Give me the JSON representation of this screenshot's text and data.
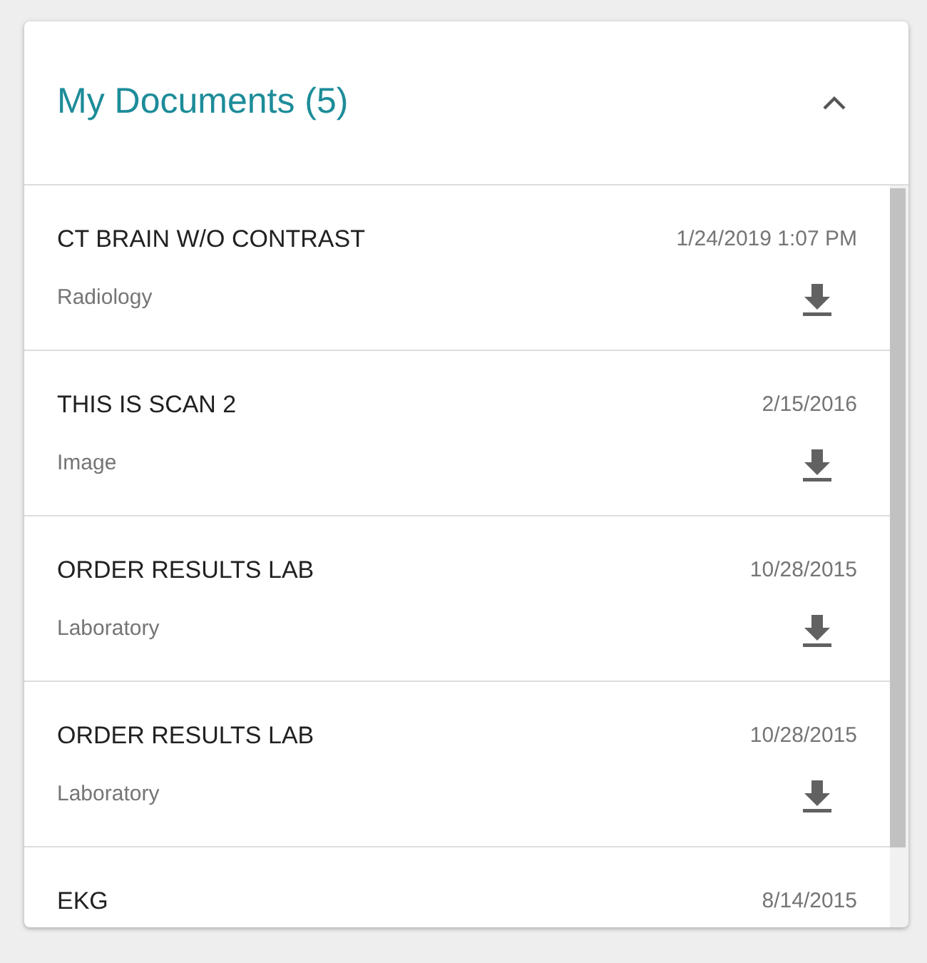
{
  "panel": {
    "title": "My Documents (5)",
    "expanded": true
  },
  "documents": [
    {
      "name": "CT BRAIN W/O CONTRAST",
      "date": "1/24/2019 1:07 PM",
      "category": "Radiology"
    },
    {
      "name": "THIS IS SCAN 2",
      "date": "2/15/2016",
      "category": "Image"
    },
    {
      "name": "ORDER RESULTS LAB",
      "date": "10/28/2015",
      "category": "Laboratory"
    },
    {
      "name": "ORDER RESULTS LAB",
      "date": "10/28/2015",
      "category": "Laboratory"
    },
    {
      "name": "EKG",
      "date": "8/14/2015"
    }
  ]
}
